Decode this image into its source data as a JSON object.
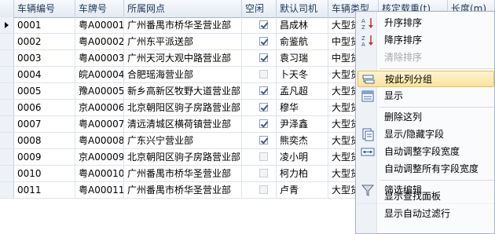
{
  "grid": {
    "columns": [
      {
        "label": "车辆编号"
      },
      {
        "label": "车牌号"
      },
      {
        "label": "所属网点"
      },
      {
        "label": "空闲"
      },
      {
        "label": "默认司机"
      },
      {
        "label": "车辆类型"
      },
      {
        "label": "核定载重(t)"
      },
      {
        "label": "长度(m)"
      }
    ],
    "rows": [
      {
        "id": "0001",
        "plate": "粤A00001",
        "branch": "广州番禺市桥华圣营业部",
        "idle": true,
        "driver": "昌成林",
        "type": "大型货"
      },
      {
        "id": "0002",
        "plate": "粤A00002",
        "branch": "广州东平派送部",
        "idle": true,
        "driver": "俞鉴航",
        "type": "中型货"
      },
      {
        "id": "0003",
        "plate": "粤A00003",
        "branch": "广州天河大观中路营业部",
        "idle": true,
        "driver": "袁习瑞",
        "type": "中型货"
      },
      {
        "id": "0004",
        "plate": "皖A00004",
        "branch": "合肥瑶海营业部",
        "idle": false,
        "driver": "卜天冬",
        "type": "大型货"
      },
      {
        "id": "0005",
        "plate": "豫A00005",
        "branch": "新乡高新区牧野大道营业部",
        "idle": true,
        "driver": "孟凡超",
        "type": "大型货"
      },
      {
        "id": "0006",
        "plate": "京A00006",
        "branch": "北京朝阳区驹子房路营业部",
        "idle": true,
        "driver": "穆华",
        "type": "大型货"
      },
      {
        "id": "0007",
        "plate": "粤A00007",
        "branch": "清远清城区横荷镇营业部",
        "idle": true,
        "driver": "尹泽鑫",
        "type": "大型货"
      },
      {
        "id": "0008",
        "plate": "粤A00008",
        "branch": "广东兴宁营业部",
        "idle": true,
        "driver": "熊奕杰",
        "type": "大型货"
      },
      {
        "id": "0009",
        "plate": "京A00009",
        "branch": "北京朝阳区驹子房路营业部",
        "idle": false,
        "driver": "凌小明",
        "type": "大型货"
      },
      {
        "id": "0010",
        "plate": "粤A00010",
        "branch": "广州番禺市桥华圣营业部",
        "idle": false,
        "driver": "柯力柏",
        "type": "大型货"
      },
      {
        "id": "0011",
        "plate": "粤A00011",
        "branch": "广州番禺市桥华圣营业部",
        "idle": false,
        "driver": "卢青",
        "type": "大型货"
      }
    ]
  },
  "menu": {
    "sort_asc": "升序排序",
    "sort_desc": "降序排序",
    "clear_sort": "清除排序",
    "group_by_column": "按此列分组",
    "show": "显示",
    "delete_column": "删除这列",
    "show_hide_fields": "显示/隐藏字段",
    "auto_width": "自动调整字段宽度",
    "auto_width_all": "自动调整所有字段宽度",
    "filter_edit": "筛选编辑",
    "show_find_panel": "显示查找面板",
    "show_auto_filter": "显示自动过滤行"
  },
  "colors": {
    "header_text": "#1e395b",
    "menu_hover": "#fbe39a",
    "check": "#3a5b8c"
  }
}
